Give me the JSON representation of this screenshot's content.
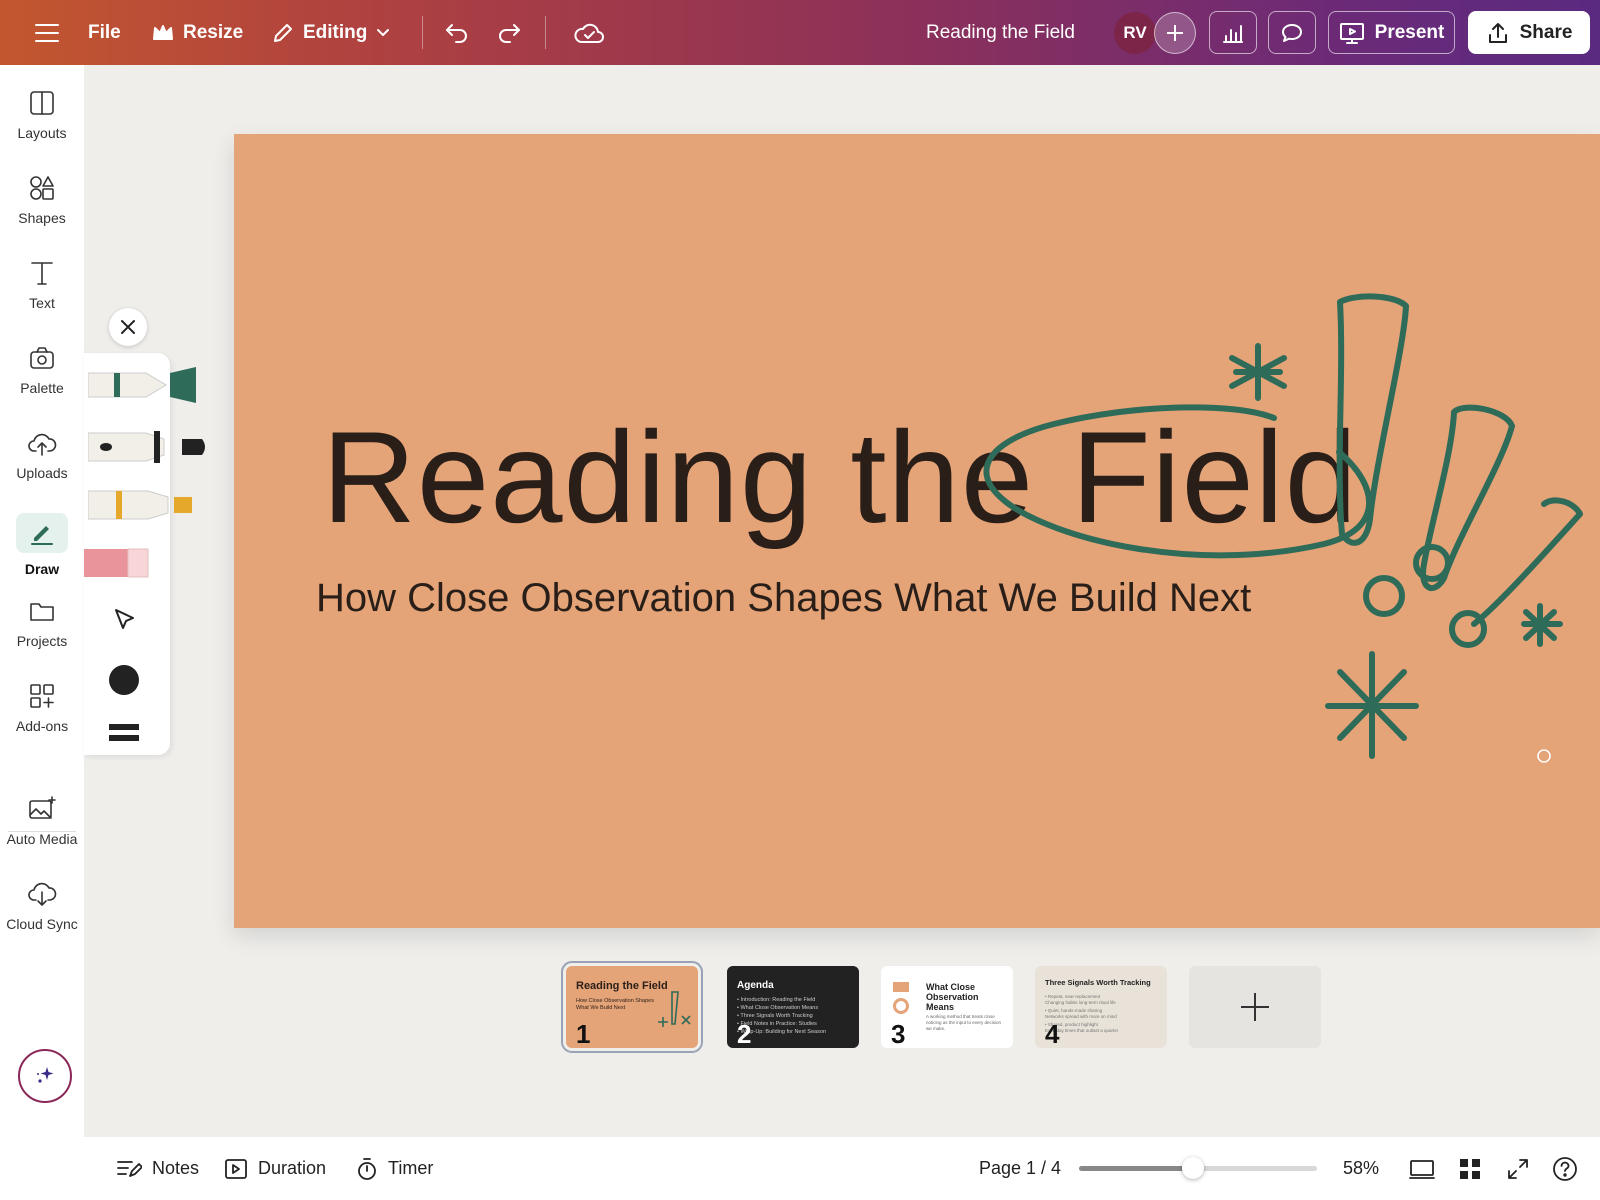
{
  "topbar": {
    "menu_icon": "hamburger-icon",
    "file_label": "File",
    "resize_label": "Resize",
    "editing_label": "Editing",
    "doc_title": "Reading the Field",
    "avatar_initials": "RV",
    "present_label": "Present",
    "share_label": "Share"
  },
  "sidebar": {
    "items": [
      {
        "label": "Layouts",
        "icon": "layout-icon"
      },
      {
        "label": "Shapes",
        "icon": "shapes-icon"
      },
      {
        "label": "Text",
        "icon": "text-icon"
      },
      {
        "label": "Palette",
        "icon": "camera-icon"
      },
      {
        "label": "Uploads",
        "icon": "cloud-upload-icon"
      },
      {
        "label": "Draw",
        "icon": "pen-icon"
      },
      {
        "label": "Projects",
        "icon": "folder-icon"
      },
      {
        "label": "Add-ons",
        "icon": "grid-plus-icon"
      },
      {
        "label": "Auto Media",
        "icon": "image-sparkle-icon"
      },
      {
        "label": "Cloud Sync",
        "icon": "cloud-download-icon"
      }
    ],
    "active": "Draw"
  },
  "draw_tools": {
    "colors": {
      "pen": "#2e6b58",
      "marker": "#222222",
      "highlighter": "#e6a82a",
      "eraser": "#e8949a"
    }
  },
  "slide": {
    "title": "Reading the Field",
    "subtitle": "How Close Observation Shapes What We Build Next",
    "background": "#e5a378",
    "doodle_color": "#2e6b58"
  },
  "thumbnails": [
    {
      "number": "1",
      "title": "Reading the Field",
      "sub": "How Close Observation Shapes What We Build Next",
      "selected": true
    },
    {
      "number": "2",
      "title": "Agenda",
      "lines": [
        "• Introduction: Reading the Field",
        "• What Close Observation Means",
        "• Three Signals Worth Tracking",
        "• Field Notes in Practice: Studies",
        "• Wrap-Up: Building for Next Season"
      ]
    },
    {
      "number": "3",
      "title": "What Close Observation Means",
      "sub": "A working method that treats close noticing as the input to every decision we make."
    },
    {
      "number": "4",
      "title": "Three Signals Worth Tracking",
      "lines": [
        "• Repeat, near-replacement",
        "  Changing habits long-term ritual life",
        "• Quiet, hands-made sharing",
        "  Networks spread with more on mind",
        "• Shared, product highlight",
        "  Everyday times that outlast a quarter"
      ]
    }
  ],
  "bottombar": {
    "notes_label": "Notes",
    "duration_label": "Duration",
    "timer_label": "Timer",
    "page_indicator": "Page 1 / 4",
    "zoom_fraction": 0.48,
    "zoom_label": "58%"
  }
}
